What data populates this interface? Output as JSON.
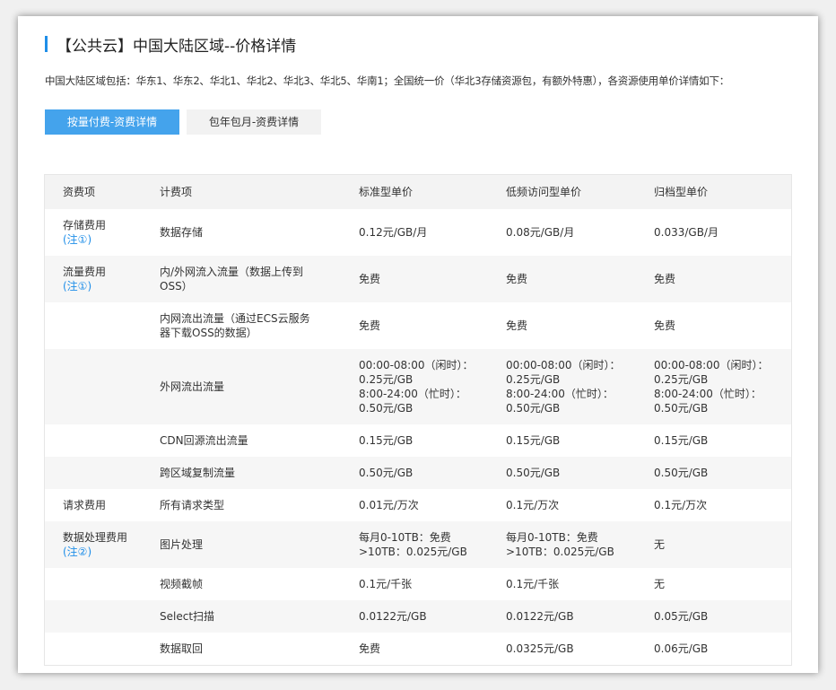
{
  "page": {
    "title": "【公共云】中国大陆区域--价格详情",
    "description": "中国大陆区域包括：华东1、华东2、华北1、华北2、华北3、华北5、华南1；全国统一价（华北3存储资源包，有额外特惠），各资源使用单价详情如下："
  },
  "tabs": [
    {
      "label": "按量付费-资费详情",
      "active": true
    },
    {
      "label": "包年包月-资费详情",
      "active": false
    }
  ],
  "colors": {
    "accent": "#44a3ec",
    "link": "#1f8ee8"
  },
  "table": {
    "headers": [
      "资费项",
      "计费项",
      "标准型单价",
      "低频访问型单价",
      "归档型单价"
    ],
    "rows": [
      {
        "category": "存储费用",
        "note": "(注①)",
        "item": "数据存储",
        "standard": "0.12元/GB/月",
        "ia": "0.08元/GB/月",
        "archive": "0.033/GB/月"
      },
      {
        "category": "流量费用",
        "note": "(注①)",
        "item": "内/外网流入流量（数据上传到OSS）",
        "standard": "免费",
        "ia": "免费",
        "archive": "免费"
      },
      {
        "category": "",
        "note": "",
        "item": "内网流出流量（通过ECS云服务器下载OSS的数据）",
        "standard": "免费",
        "ia": "免费",
        "archive": "免费"
      },
      {
        "category": "",
        "note": "",
        "item": "外网流出流量",
        "standard": "00:00-08:00（闲时）：0.25元/GB\n8:00-24:00（忙时）：0.50元/GB",
        "ia": "00:00-08:00（闲时）：0.25元/GB\n8:00-24:00（忙时）：0.50元/GB",
        "archive": "00:00-08:00（闲时）：0.25元/GB\n8:00-24:00（忙时）：0.50元/GB"
      },
      {
        "category": "",
        "note": "",
        "item": "CDN回源流出流量",
        "standard": "0.15元/GB",
        "ia": "0.15元/GB",
        "archive": "0.15元/GB"
      },
      {
        "category": "",
        "note": "",
        "item": "跨区域复制流量",
        "standard": "0.50元/GB",
        "ia": "0.50元/GB",
        "archive": "0.50元/GB"
      },
      {
        "category": "请求费用",
        "note": "",
        "item": "所有请求类型",
        "standard": "0.01元/万次",
        "ia": "0.1元/万次",
        "archive": "0.1元/万次"
      },
      {
        "category": "数据处理费用",
        "note": "(注②)",
        "item": "图片处理",
        "standard": "每月0-10TB：免费\n>10TB：0.025元/GB",
        "ia": "每月0-10TB：免费\n>10TB：0.025元/GB",
        "archive": "无"
      },
      {
        "category": "",
        "note": "",
        "item": "视频截帧",
        "standard": "0.1元/千张",
        "ia": "0.1元/千张",
        "archive": "无"
      },
      {
        "category": "",
        "note": "",
        "item": "Select扫描",
        "standard": "0.0122元/GB",
        "ia": "0.0122元/GB",
        "archive": "0.05元/GB"
      },
      {
        "category": "",
        "note": "",
        "item": "数据取回",
        "standard": "免费",
        "ia": "0.0325元/GB",
        "archive": "0.06元/GB"
      }
    ]
  }
}
